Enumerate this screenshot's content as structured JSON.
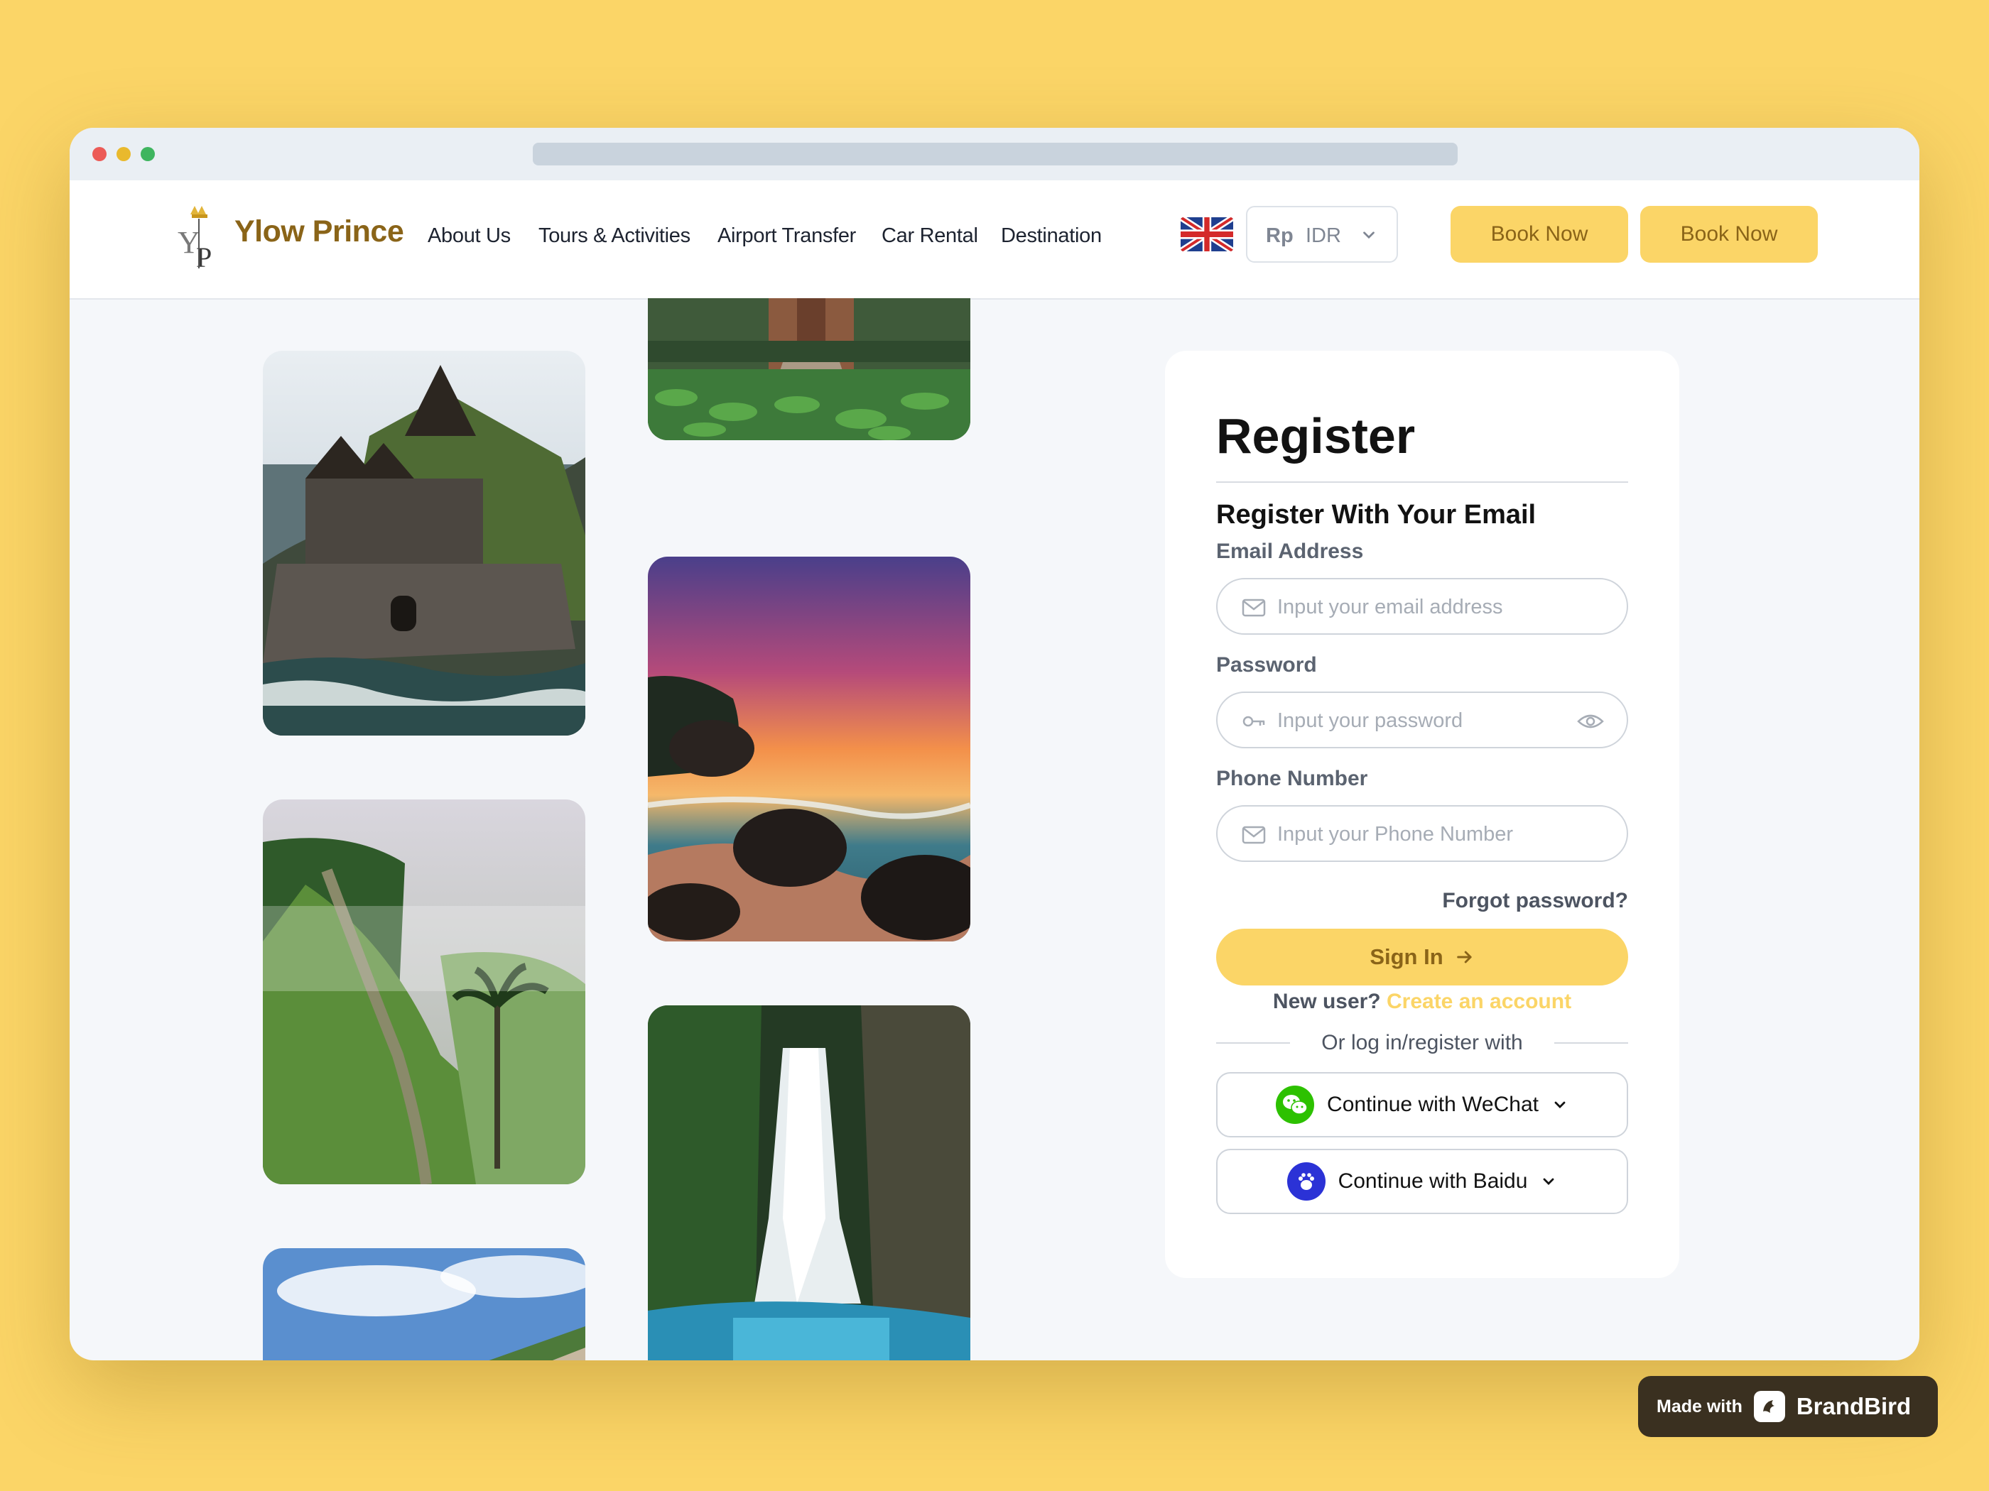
{
  "brand": {
    "name": "Ylow Prince",
    "accent": "#fbd567",
    "brown": "#8a6418",
    "background": "#fbd567"
  },
  "nav": {
    "links": [
      "About Us",
      "Tours & Activities",
      "Airport Transfer",
      "Car Rental",
      "Destination"
    ],
    "currency_symbol": "Rp",
    "currency_code": "IDR",
    "language_flag": "uk-flag-icon",
    "book_buttons": [
      "Book Now",
      "Book Now"
    ]
  },
  "gallery": {
    "images": [
      "bali-temple-on-sea-rock",
      "temple-lotus-pond",
      "sunset-beach-rocks",
      "misty-green-hills-palm",
      "waterfall-jungle",
      "coastal-cliff-sky"
    ]
  },
  "register": {
    "title": "Register",
    "subtitle": "Register With Your Email",
    "email_label": "Email Address",
    "email_placeholder": "Input your email address",
    "password_label": "Password",
    "password_placeholder": "Input your password",
    "phone_label": "Phone Number",
    "phone_placeholder": "Input your Phone Number",
    "forgot": "Forgot password?",
    "signin": "Sign In",
    "new_user": "New user?",
    "create_account": "Create an account",
    "or_text": "Or log in/register with",
    "wechat": "Continue with WeChat",
    "baidu": "Continue with Baidu"
  },
  "watermark": {
    "made_with": "Made with",
    "name": "BrandBird"
  }
}
